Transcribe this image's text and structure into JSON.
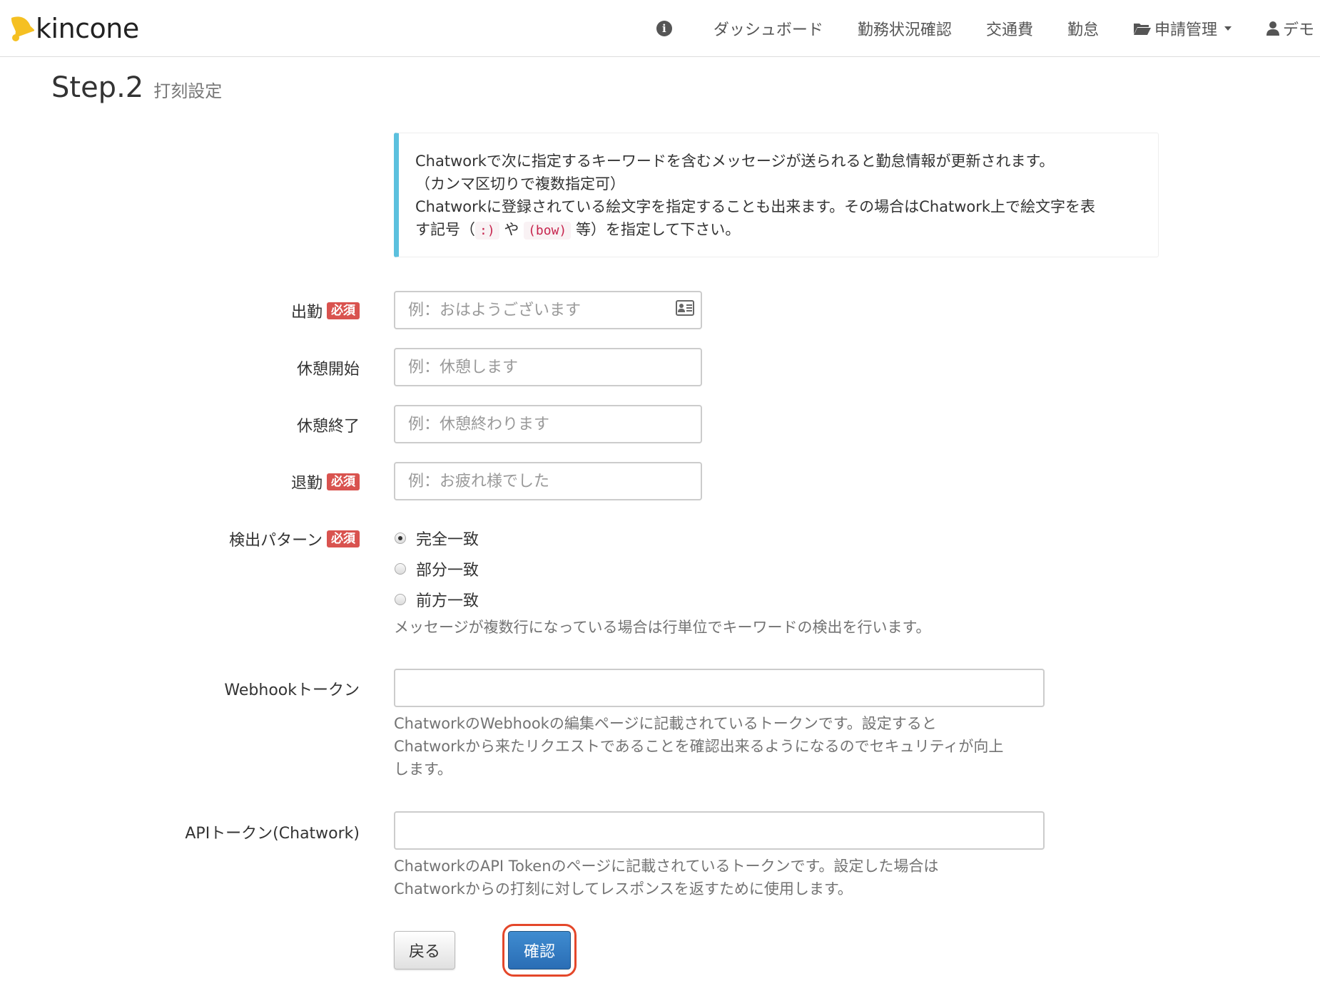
{
  "nav": {
    "brand": "kincone",
    "items": [
      {
        "label": "ダッシュボード"
      },
      {
        "label": "勤務状況確認"
      },
      {
        "label": "交通費"
      },
      {
        "label": "勤怠"
      },
      {
        "label": "申請管理"
      },
      {
        "label": "デモ"
      }
    ]
  },
  "header": {
    "title": "Step.2",
    "subtitle": "打刻設定"
  },
  "callout": {
    "line1": "Chatworkで次に指定するキーワードを含むメッセージが送られると勤怠情報が更新されます。",
    "line2": "（カンマ区切りで複数指定可）",
    "line3": "Chatworkに登録されている絵文字を指定することも出来ます。その場合はChatwork上で絵文字を表",
    "line4_a": "す記号（",
    "code1": ":)",
    "line4_b": "や",
    "code2": "(bow)",
    "line4_c": "等）を指定して下さい。"
  },
  "form": {
    "required_badge": "必須",
    "clock_in": {
      "label": "出勤",
      "placeholder": "例：おはようございます",
      "value": ""
    },
    "break_start": {
      "label": "休憩開始",
      "placeholder": "例：休憩します",
      "value": ""
    },
    "break_end": {
      "label": "休憩終了",
      "placeholder": "例：休憩終わります",
      "value": ""
    },
    "clock_out": {
      "label": "退勤",
      "placeholder": "例：お疲れ様でした",
      "value": ""
    },
    "detection": {
      "label": "検出パターン",
      "options": [
        "完全一致",
        "部分一致",
        "前方一致"
      ],
      "selected": "完全一致",
      "help": "メッセージが複数行になっている場合は行単位でキーワードの検出を行います。"
    },
    "webhook": {
      "label": "Webhookトークン",
      "value": "",
      "help1": "ChatworkのWebhookの編集ページに記載されているトークンです。設定すると",
      "help2": "Chatworkから来たリクエストであることを確認出来るようになるのでセキュリティが向上",
      "help3": "します。"
    },
    "api": {
      "label": "APIトークン(Chatwork)",
      "value": "",
      "help1": "ChatworkのAPI Tokenのページに記載されているトークンです。設定した場合は",
      "help2": "Chatworkからの打刻に対してレスポンスを返すために使用します。"
    }
  },
  "buttons": {
    "back": "戻る",
    "confirm": "確認"
  },
  "colors": {
    "info_border": "#5bc0de",
    "required": "#d9534f",
    "primary": "#337ab7",
    "highlight_ring": "#e4472a"
  }
}
